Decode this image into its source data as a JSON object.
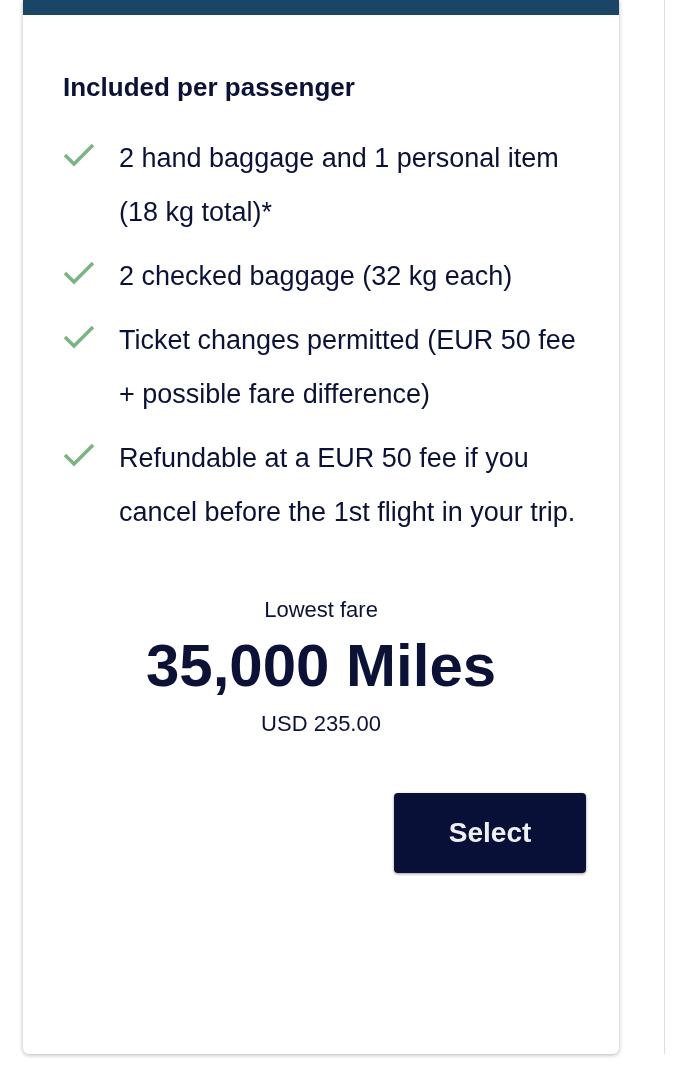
{
  "card": {
    "heading": "Included per passenger",
    "features": [
      "2 hand baggage and 1 personal item (18 kg total)*",
      "2 checked baggage (32 kg each)",
      "Ticket changes permitted (EUR 50 fee + possible fare difference)",
      "Refundable at a EUR 50 fee if you cancel before the 1st flight in your trip."
    ],
    "fare_label": "Lowest fare",
    "miles": "35,000 Miles",
    "price": "USD 235.00",
    "button": "Select"
  }
}
